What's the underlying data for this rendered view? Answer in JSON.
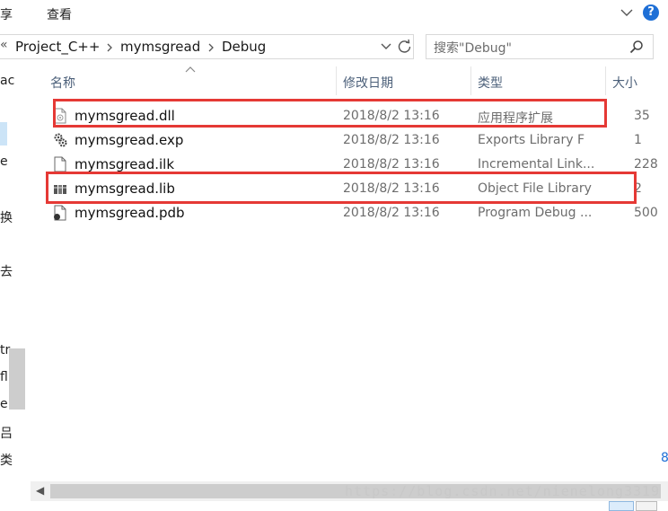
{
  "ribbon": {
    "tabs": [
      "享",
      "查看"
    ]
  },
  "address": {
    "overflow": "«",
    "crumbs": [
      "Project_C++",
      "mymsgread",
      "Debug"
    ]
  },
  "search": {
    "placeholder": "搜索\"Debug\""
  },
  "leftnav": {
    "fragments": [
      "ac",
      "e",
      "换",
      "去",
      "tr",
      "fl",
      "e",
      "吕",
      "类"
    ]
  },
  "columns": {
    "name": "名称",
    "date": "修改日期",
    "type": "类型",
    "size": "大小"
  },
  "files": [
    {
      "name": "mymsgread.dll",
      "date": "2018/8/2 13:16",
      "type": "应用程序扩展",
      "size": "35",
      "icon": "dll-file-icon"
    },
    {
      "name": "mymsgread.exp",
      "date": "2018/8/2 13:16",
      "type": "Exports Library F",
      "size": "1",
      "icon": "exp-gear-file-icon"
    },
    {
      "name": "mymsgread.ilk",
      "date": "2018/8/2 13:16",
      "type": "Incremental Link...",
      "size": "228",
      "icon": "ilk-file-icon"
    },
    {
      "name": "mymsgread.lib",
      "date": "2018/8/2 13:16",
      "type": "Object File Library",
      "size": "2",
      "icon": "lib-books-icon"
    },
    {
      "name": "mymsgread.pdb",
      "date": "2018/8/2 13:16",
      "type": "Program Debug ...",
      "size": "500",
      "icon": "pdb-file-icon"
    }
  ],
  "watermark": "https://blog.csdn.net/nienelong3319",
  "right_edge_fragment": "8",
  "colors": {
    "highlight": "#e53935",
    "help": "#1e6fd6",
    "header_text": "#4c607a"
  }
}
